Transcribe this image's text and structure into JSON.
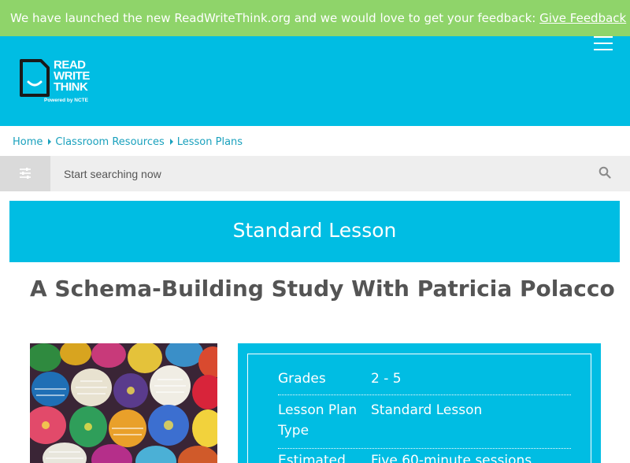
{
  "banner": {
    "text": "We have launched the new ReadWriteThink.org and we would love to get your feedback: ",
    "link": "Give Feedback"
  },
  "logo": {
    "line1": "READ",
    "line2": "WRITE",
    "line3": "THINK",
    "tagline": "Powered by NCTE"
  },
  "breadcrumb": [
    "Home",
    "Classroom Resources",
    "Lesson Plans"
  ],
  "search": {
    "placeholder": "Start searching now"
  },
  "lesson_type_banner": "Standard Lesson",
  "title": "A Schema-Building Study With Patricia Polacco",
  "details": [
    {
      "key": "Grades",
      "value": "2 - 5"
    },
    {
      "key": "Lesson Plan Type",
      "value": "Standard Lesson"
    },
    {
      "key": "Estimated",
      "value": "Five 60-minute sessions"
    }
  ],
  "colors": {
    "banner": "#8fd46a",
    "brand": "#00bde3",
    "title": "#545454",
    "link": "#1aa1bd"
  }
}
